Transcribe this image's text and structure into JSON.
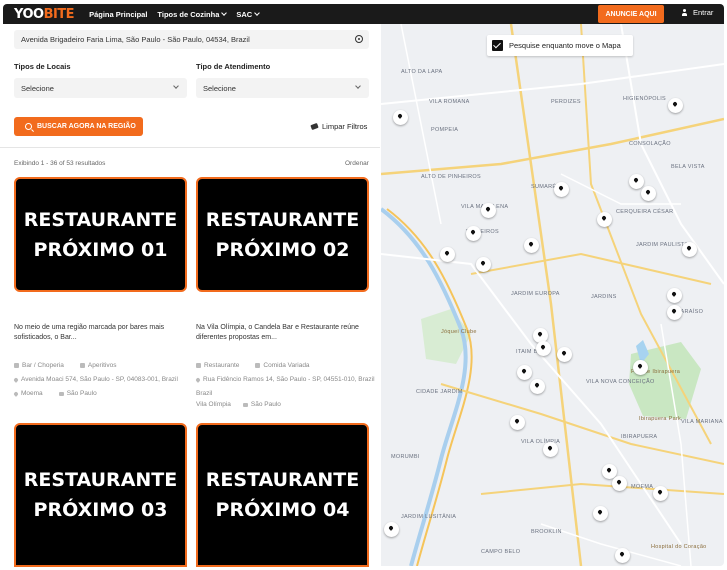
{
  "header": {
    "logo_main": "YOO",
    "logo_accent": "BITE",
    "nav": [
      "Página Principal",
      "Tipos de Cozinha",
      "SAC"
    ],
    "cta_label": "ANUNCIE AQUI",
    "login_label": "Entrar"
  },
  "filters": {
    "address_value": "Avenida Brigadeiro Faria Lima, São Paulo - São Paulo, 04534, Brazil",
    "place_type_label": "Tipos de Locais",
    "place_type_value": "Selecione",
    "service_type_label": "Tipo de Atendimento",
    "service_type_value": "Selecione",
    "search_button": "BUSCAR AGORA NA REGIÃO",
    "clear_label": "Limpar Filtros"
  },
  "results": {
    "count_text": "Exibindo 1 - 36 of 53 resultados",
    "order_label": "Ordenar"
  },
  "cards": [
    {
      "title_line1": "RESTAURANTE",
      "title_line2": "PRÓXIMO 01",
      "description": "No meio de uma região marcada por bares mais sofisticados, o Bar...",
      "category": "Bar / Choperia",
      "tag": "Aperitivos",
      "address": "Avenida Moaci 574, São Paulo - SP, 04083-001, Brazil",
      "neighborhood": "Moema",
      "city": "São Paulo"
    },
    {
      "title_line1": "RESTAURANTE",
      "title_line2": "PRÓXIMO 02",
      "description": "Na Vila Olímpia, o Candela Bar e Restaurante reúne diferentes propostas em...",
      "category": "Restaurante",
      "tag": "Comida Variada",
      "address": "Rua Fidêncio Ramos 14, São Paulo - SP, 04551-010, Brazil",
      "neighborhood": "Vila Olímpia",
      "city": "São Paulo"
    },
    {
      "title_line1": "RESTAURANTE",
      "title_line2": "PRÓXIMO 03"
    },
    {
      "title_line1": "RESTAURANTE",
      "title_line2": "PRÓXIMO 04"
    }
  ],
  "map": {
    "toggle_label": "Pesquise enquanto move o Mapa",
    "labels": [
      "ALTO DA LAPA",
      "VILA ROMANA",
      "POMPEIA",
      "PERDIZES",
      "HIGIENÓPOLIS",
      "CONSOLAÇÃO",
      "BELA VISTA",
      "PINHEIROS",
      "JARDIM EUROPA",
      "JARDINS",
      "JARDIM PAULISTA",
      "CERQUEIRA CÉSAR",
      "CIDADE JARDIM",
      "MORUMBI",
      "ITAIM BIBI",
      "VILA OLÍMPIA",
      "IBIRAPUERA",
      "PARAÍSO",
      "VILA MARIANA",
      "MOEMA",
      "BROOKLIN",
      "CAMPO BELO",
      "JARDIM LUSITÂNIA",
      "VILA MADALENA",
      "SUMARÉ",
      "ALTO DE PINHEIROS",
      "VILA NOVA CONCEIÇÃO",
      "Parque Ibirapuera",
      "Ibirapuera Park",
      "Jóquei Clube",
      "Hospital do Coração"
    ]
  },
  "colors": {
    "accent": "#f26b1d",
    "header_bg": "#1a1a1a",
    "card_bg": "#000000"
  }
}
